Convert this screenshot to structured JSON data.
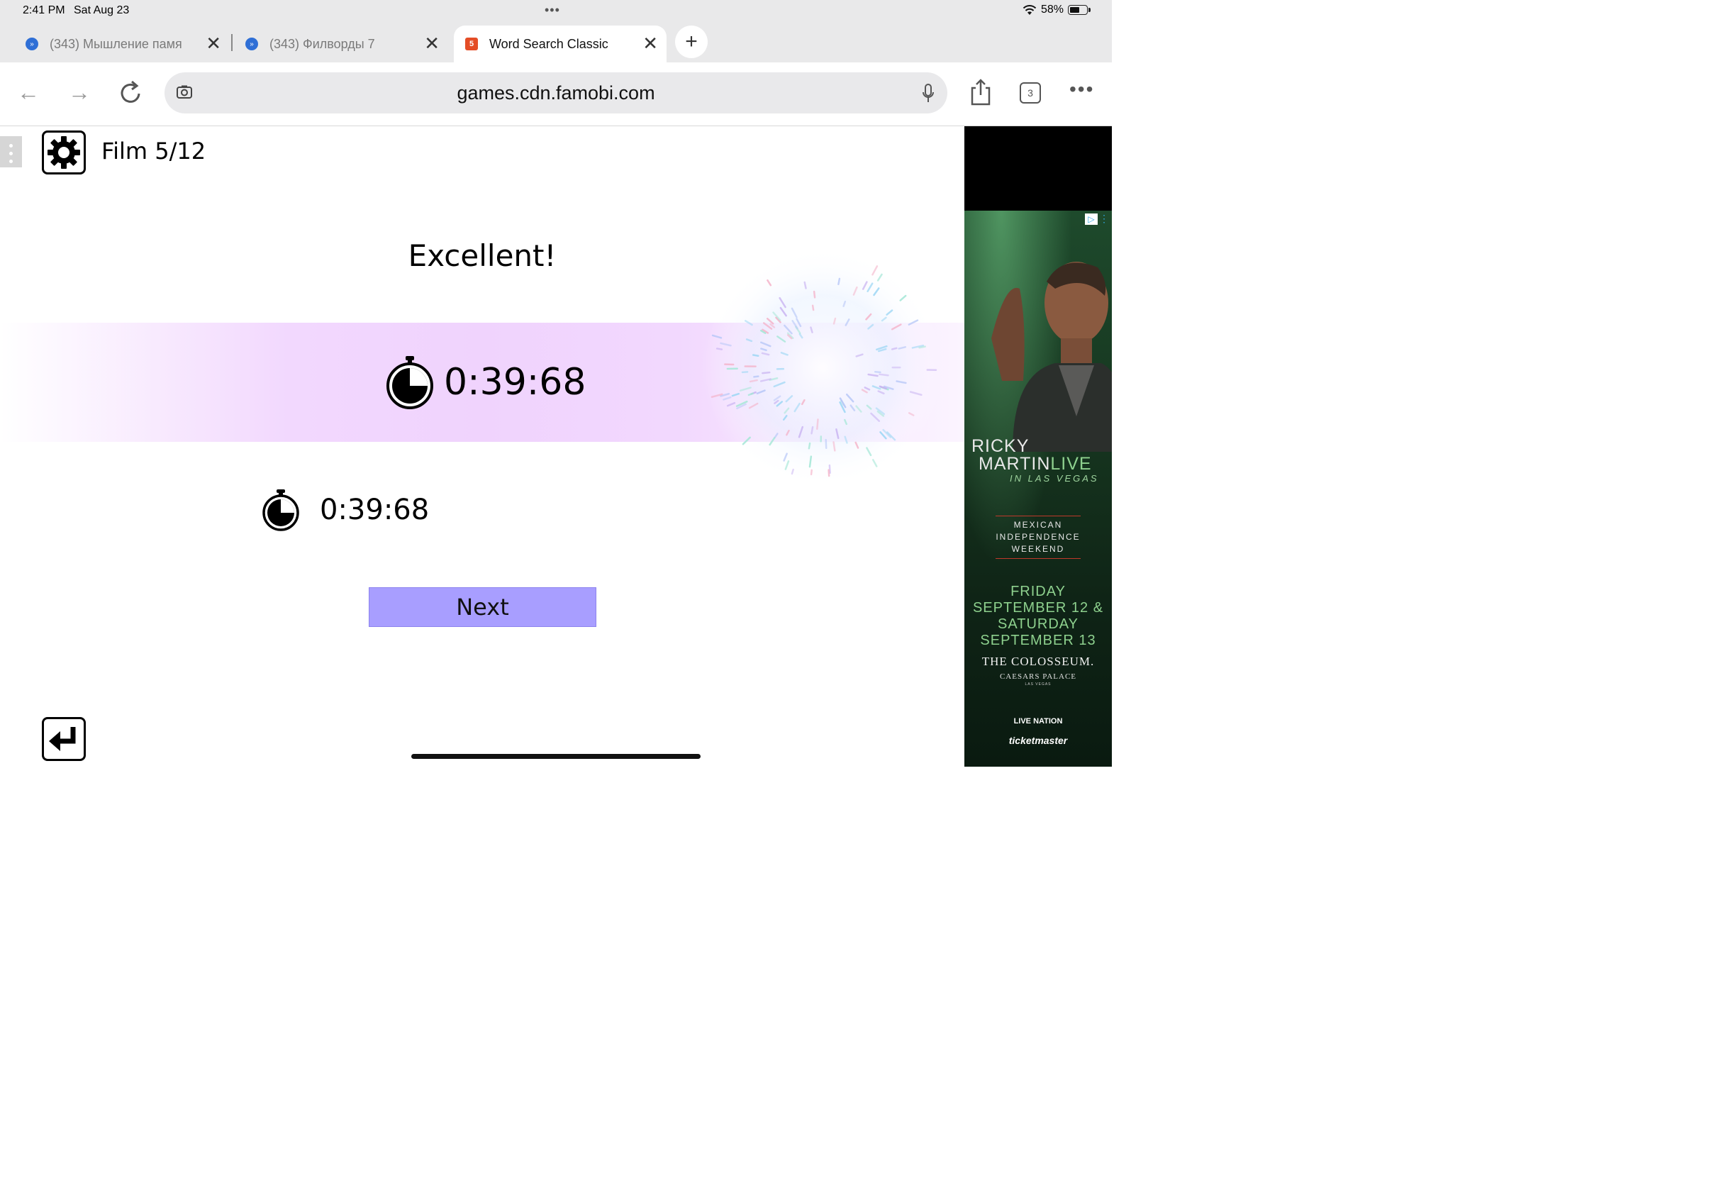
{
  "status_bar": {
    "time": "2:41 PM",
    "date": "Sat Aug 23",
    "battery": "58%"
  },
  "tabs": [
    {
      "title": "(343) Мышление памя",
      "active": false
    },
    {
      "title": "(343) Филворды 7",
      "active": false
    },
    {
      "title": "Word Search Classic",
      "active": true
    }
  ],
  "address_bar": {
    "url": "games.cdn.famobi.com"
  },
  "tab_count": "3",
  "game": {
    "level_label": "Film 5/12",
    "result_title": "Excellent!",
    "current_time": "0:39:68",
    "best_time": "0:39:68",
    "next_label": "Next"
  },
  "ad": {
    "name_line1": "RICKY",
    "name_line2": "MARTIN",
    "live": "LIVE",
    "location": "IN LAS VEGAS",
    "event_line1": "MEXICAN",
    "event_line2": "INDEPENDENCE",
    "event_line3": "WEEKEND",
    "dates_line1": "FRIDAY",
    "dates_line2": "SEPTEMBER 12 &",
    "dates_line3": "SATURDAY",
    "dates_line4": "SEPTEMBER 13",
    "venue": "THE COLOSSEUM.",
    "venue2": "CAESARS PALACE",
    "venue3": "LAS VEGAS",
    "sponsor1": "LIVE NATION",
    "sponsor2": "ticketmaster"
  },
  "colors": {
    "next_button": "#a89eff",
    "band": "#f0d3fd"
  }
}
